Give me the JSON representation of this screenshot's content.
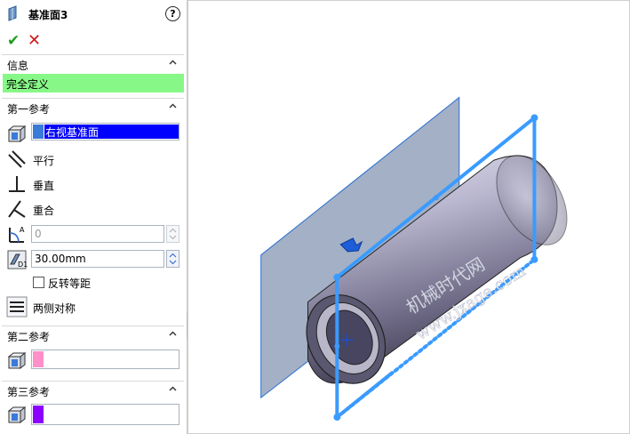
{
  "header": {
    "title": "基准面3",
    "help_label": "?",
    "ok_label": "✔",
    "cancel_label": "✕"
  },
  "info": {
    "section_title": "信息",
    "status": "完全定义"
  },
  "first_ref": {
    "section_title": "第一参考",
    "selection": "右视基准面",
    "options": {
      "parallel": "平行",
      "perpendicular": "垂直",
      "coincident": "重合"
    },
    "angle_value": "0",
    "distance_value": "30.00mm",
    "flip_label": "反转等距",
    "mid_plane_label": "两侧对称"
  },
  "second_ref": {
    "section_title": "第二参考",
    "swatch_color": "#ff8fc8"
  },
  "third_ref": {
    "section_title": "第三参考",
    "swatch_color": "#8c00ff"
  },
  "watermark": {
    "line1": "机械时代网",
    "line2": "www.jxage.com"
  },
  "colors": {
    "accent": "#2b8cff",
    "status_bg": "#87f887",
    "selection_bg": "#0000ff"
  }
}
